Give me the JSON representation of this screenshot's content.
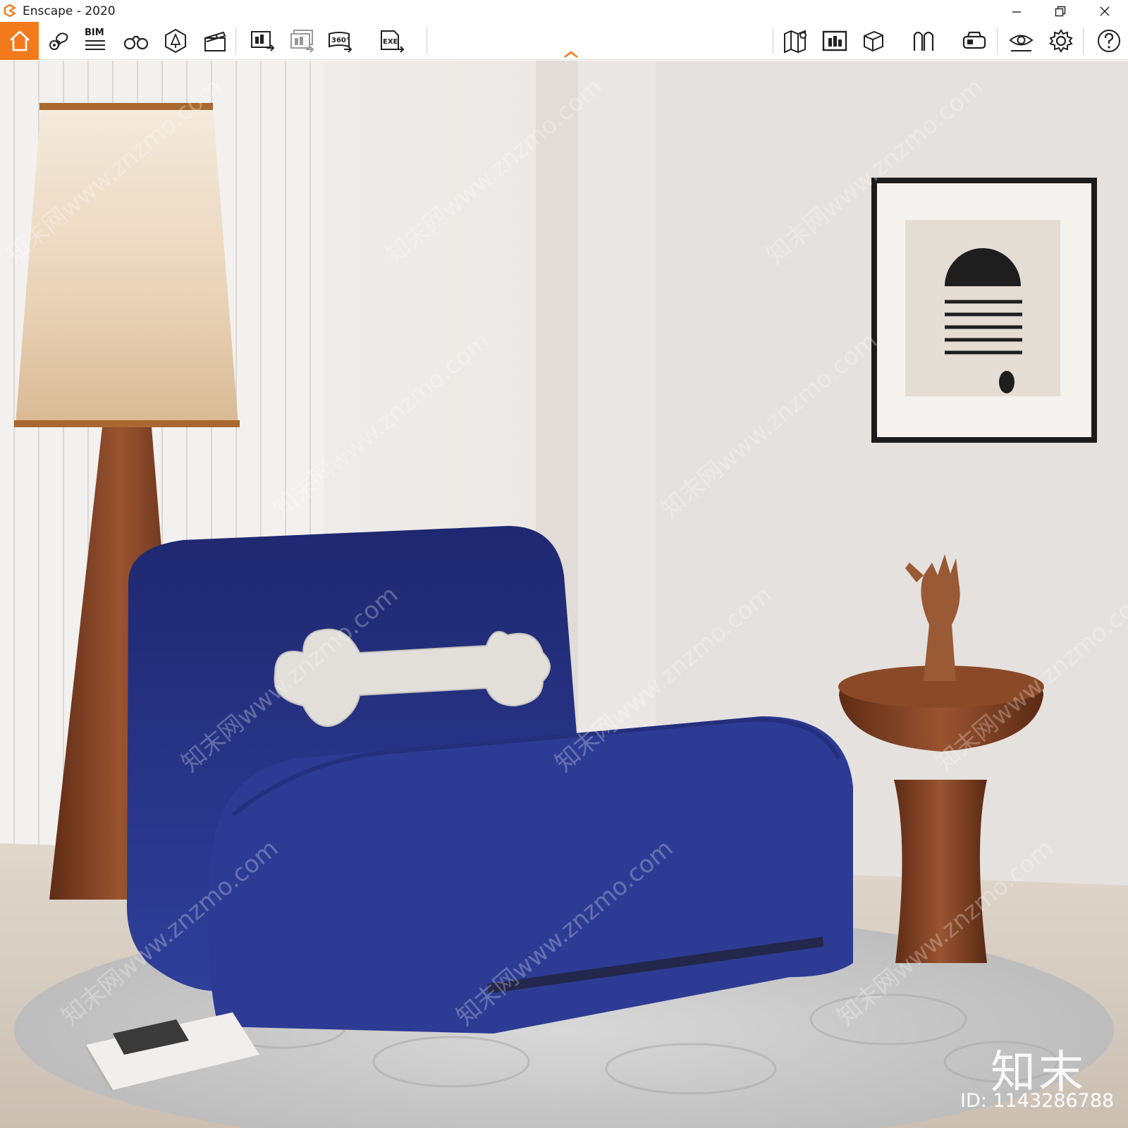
{
  "window": {
    "title": "Enscape - 2020"
  },
  "toolbar": {
    "bim_label": "BIM",
    "accent_color": "#f27a1c",
    "left_tools": [
      "home-icon",
      "views-icon",
      "bim-icon",
      "binoculars-icon",
      "asset-library-icon",
      "video-editor-icon",
      "render-screenshot-icon",
      "batch-render-icon",
      "panorama-360-icon",
      "exe-export-icon"
    ],
    "right_tools": [
      "map-icon",
      "minimap-icon",
      "section-box-icon",
      "outline-icon",
      "vr-headset-icon",
      "visual-settings-icon",
      "general-settings-icon",
      "help-icon"
    ]
  },
  "watermark": {
    "logo_text": "知末",
    "id_text": "ID: 1143286788",
    "repeat_text": "知末网www.znzmo.com"
  },
  "scene": {
    "colors": {
      "wall": "#e6e2df",
      "sofa": "#27348a",
      "wood": "#7a3f22",
      "lampshade": "#ead9c2",
      "rug": "#cfcfcf",
      "floor": "#d9cfc3"
    }
  }
}
